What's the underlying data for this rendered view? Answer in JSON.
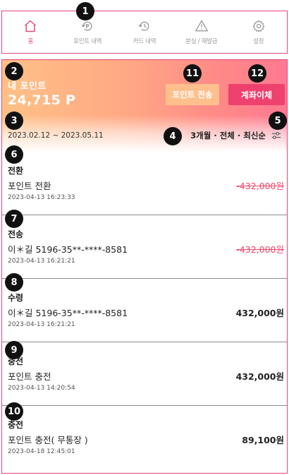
{
  "nav": {
    "items": [
      {
        "label": "홈",
        "icon": "home-icon",
        "active": true
      },
      {
        "label": "포인트 내역",
        "icon": "points-history-icon",
        "active": false
      },
      {
        "label": "카드 내역",
        "icon": "card-history-icon",
        "active": false
      },
      {
        "label": "분실 / 재발급",
        "icon": "warning-icon",
        "active": false
      },
      {
        "label": "설정",
        "icon": "gear-icon",
        "active": false
      }
    ]
  },
  "points": {
    "title": "내 포인트",
    "amount": "24,715 P",
    "transfer_button": "포인트 전송",
    "account_transfer_button": "계좌이체"
  },
  "filter": {
    "period": "2023.02.12 ~ 2023.05.11",
    "summary": "3개월 · 전체 · 최신순"
  },
  "transactions": [
    {
      "type": "전환",
      "desc": "포인트 전환",
      "time": "2023-04-13 16:23:33",
      "amount": "-432,000원",
      "cancelled": true
    },
    {
      "type": "전송",
      "desc": "이＊길 5196-35**-****-8581",
      "time": "2023-04-13 16:21:21",
      "amount": "-432,000원",
      "cancelled": true
    },
    {
      "type": "수령",
      "desc": "이＊길 5196-35**-****-8581",
      "time": "2023-04-13 16:21:21",
      "amount": "432,000원",
      "cancelled": false
    },
    {
      "type": "충전",
      "desc": "포인트 충전",
      "time": "2023-04-13 14:20:54",
      "amount": "432,000원",
      "cancelled": false
    },
    {
      "type": "충전",
      "desc": "포인트 충전( 무통장 )",
      "time": "2023-04-18 12:45:01",
      "amount": "89,100원",
      "cancelled": false
    }
  ],
  "badges": [
    "1",
    "2",
    "3",
    "4",
    "5",
    "6",
    "7",
    "8",
    "9",
    "10",
    "11",
    "12"
  ],
  "colors": {
    "accent": "#ea4a75",
    "frame": "#e3457a",
    "cancel": "#ee4a6c",
    "secondary_button": "#ffc08e"
  }
}
